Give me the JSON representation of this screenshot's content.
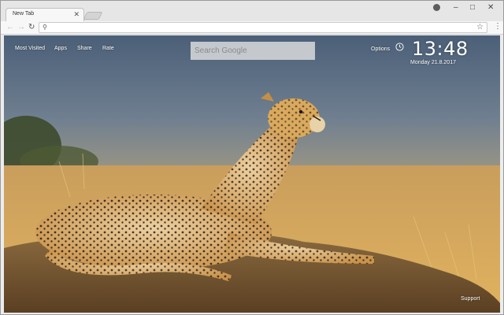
{
  "browser": {
    "tab": {
      "title": "New Tab",
      "close_icon": "close-icon"
    },
    "toolbar": {
      "search_icon": "search-icon",
      "star_icon": "star-icon",
      "menu_icon": "kebab-menu-icon",
      "url_value": ""
    },
    "window_controls": {
      "profile_icon": "profile-icon",
      "minimize": "–",
      "maximize": "□",
      "close": "✕"
    }
  },
  "newtab": {
    "nav": {
      "most_visited": "Most Visited",
      "apps": "Apps",
      "share": "Share",
      "rate": "Rate"
    },
    "search": {
      "placeholder": "Search Google"
    },
    "options": "Options",
    "clock": {
      "time": "13:48",
      "date": "Monday  21.8.2017",
      "icon": "clock-icon"
    },
    "support": "Support",
    "background": {
      "subject": "cheetah",
      "colors": {
        "sky": "#4f6a86",
        "field": "#d8a75a",
        "mound": "#7a5a35",
        "fur": "#d6a95e",
        "accent": "#ffffff"
      }
    }
  }
}
